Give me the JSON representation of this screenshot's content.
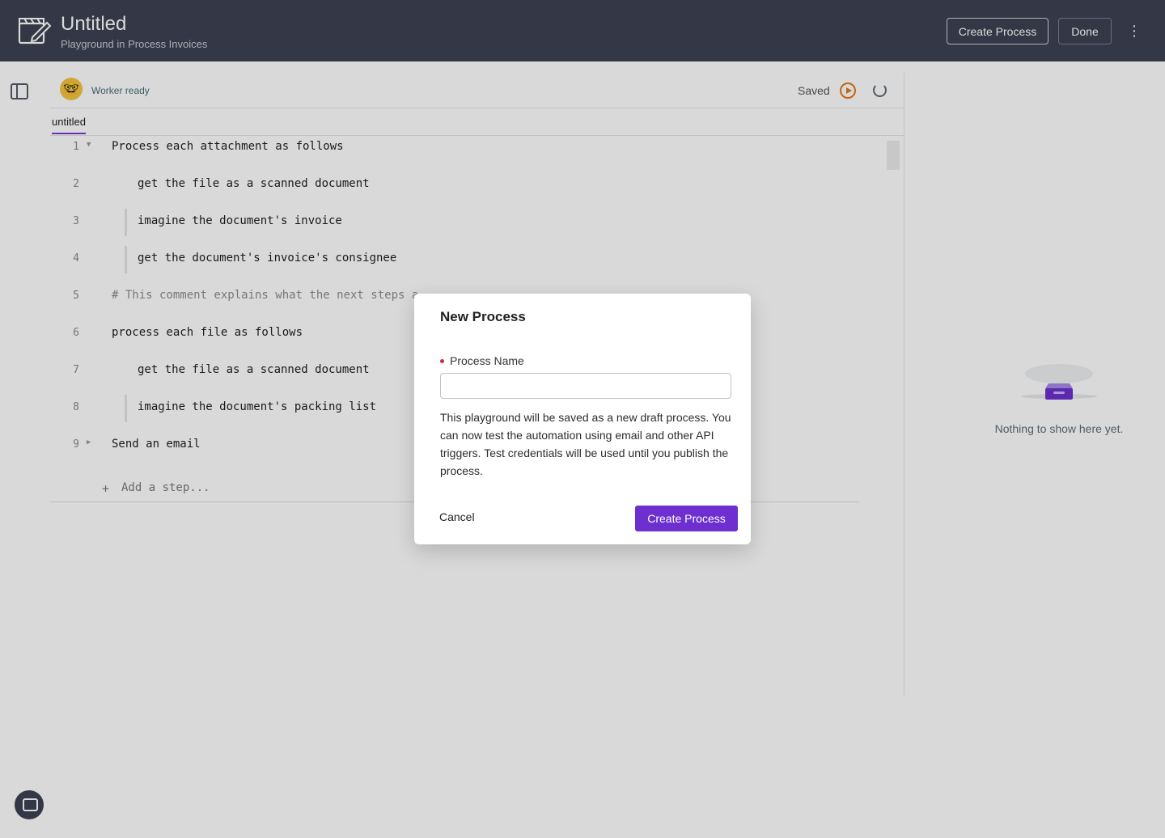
{
  "header": {
    "title": "Untitled",
    "subtitle": "Playground in Process Invoices",
    "create_process_label": "Create Process",
    "done_label": "Done",
    "more_icon": "vertical-ellipsis-icon"
  },
  "worker": {
    "status": "Worker ready",
    "avatar_emoji": "🤓",
    "saved_label": "Saved"
  },
  "tabs": [
    {
      "label": "untitled",
      "active": true
    }
  ],
  "code_lines": [
    {
      "number": "1",
      "text": "Process each attachment as follows",
      "fold": "▼"
    },
    {
      "number": "2",
      "text": "get the file as a scanned document"
    },
    {
      "number": "3",
      "text": "imagine the document's invoice"
    },
    {
      "number": "4",
      "text": "get the document's invoice's consignee"
    },
    {
      "number": "5",
      "text": "# This comment explains what the next steps a"
    },
    {
      "number": "6",
      "text": "process each file as follows"
    },
    {
      "number": "7",
      "text": "get the file as a scanned document"
    },
    {
      "number": "8",
      "text": "imagine the document's packing list"
    },
    {
      "number": "9",
      "text": "Send an email",
      "fold": "▶"
    }
  ],
  "add_step": {
    "plus": "+",
    "placeholder": "Add a step..."
  },
  "right_panel": {
    "empty_text": "Nothing to show here yet."
  },
  "modal": {
    "title": "New Process",
    "field_label": "Process Name",
    "field_value": "",
    "description": "This playground will be saved as a new draft process. You can now test the automation using email and other API triggers. Test credentials will be used until you publish the process.",
    "cancel_label": "Cancel",
    "submit_label": "Create Process"
  },
  "colors": {
    "header_bg": "#3e4152",
    "accent": "#6d2fcf",
    "run_icon": "#e07a1a",
    "required": "#d9253a"
  }
}
